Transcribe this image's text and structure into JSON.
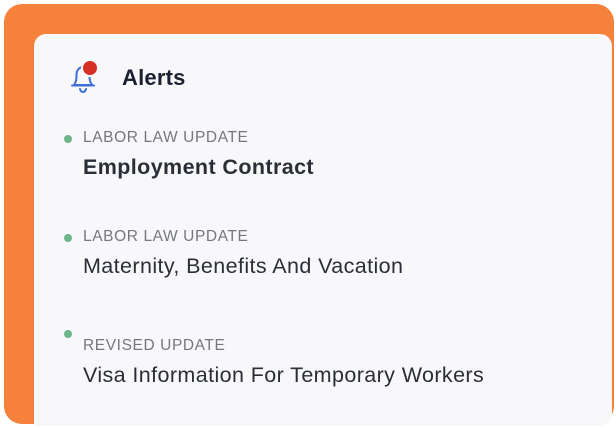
{
  "colors": {
    "background_accent": "#f5813a",
    "card": "#f8f8fa",
    "notification_dot": "#d63024",
    "status_dot": "#6db48a",
    "bell_stroke": "#3d6ed6"
  },
  "header": {
    "icon": "bell-icon",
    "title": "Alerts"
  },
  "alerts": [
    {
      "category": "LABOR LAW UPDATE",
      "title": "Employment Contract",
      "emphasis": true
    },
    {
      "category": "LABOR LAW UPDATE",
      "title": "Maternity, Benefits And Vacation",
      "emphasis": false
    },
    {
      "category": "REVISED UPDATE",
      "title": "Visa Information For Temporary Workers",
      "emphasis": false
    }
  ]
}
